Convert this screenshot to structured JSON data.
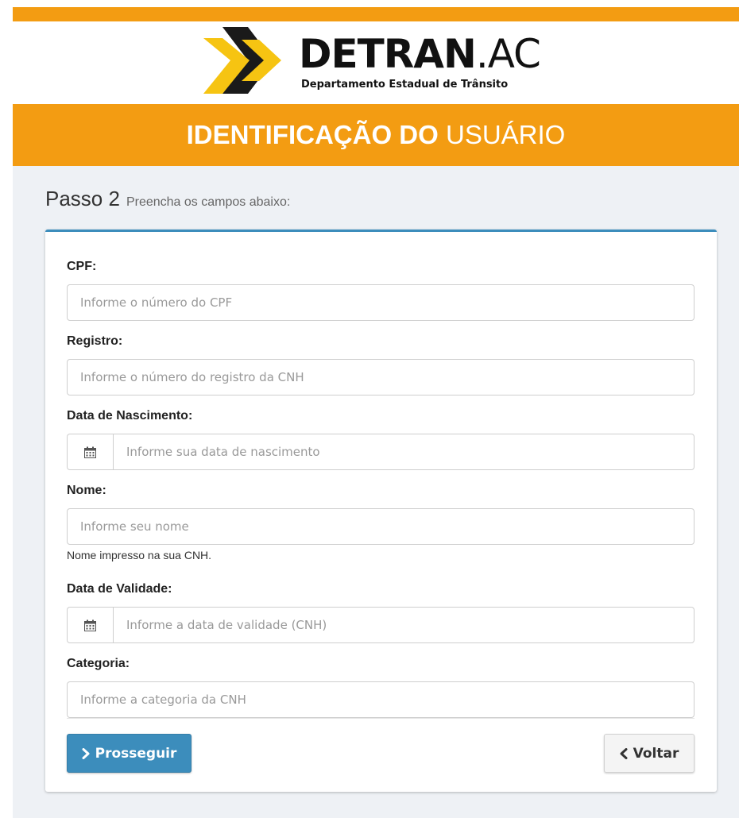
{
  "brand": {
    "name_bold": "DETRAN",
    "name_suffix": ".AC",
    "subtitle": "Departamento Estadual de Trânsito"
  },
  "banner": {
    "title_bold": "IDENTIFICAÇÃO DO",
    "title_light": "USUÁRIO"
  },
  "step": {
    "title": "Passo 2",
    "subtitle": "Preencha os campos abaixo:"
  },
  "form": {
    "cpf": {
      "label": "CPF:",
      "placeholder": "Informe o número do CPF"
    },
    "registro": {
      "label": "Registro:",
      "placeholder": "Informe o número do registro da CNH"
    },
    "nascimento": {
      "label": "Data de Nascimento:",
      "placeholder": "Informe sua data de nascimento",
      "icon": "calendar-icon"
    },
    "nome": {
      "label": "Nome:",
      "placeholder": "Informe seu nome",
      "help": "Nome impresso na sua CNH."
    },
    "validade": {
      "label": "Data de Validade:",
      "placeholder": "Informe a data de validade (CNH)",
      "icon": "calendar-icon"
    },
    "categoria": {
      "label": "Categoria:",
      "placeholder": "Informe a categoria da CNH"
    }
  },
  "actions": {
    "next_label": "Prosseguir",
    "back_label": "Voltar"
  },
  "colors": {
    "accent_orange": "#f39c12",
    "primary_blue": "#3c8dbc",
    "logo_yellow": "#f6c412",
    "logo_black": "#1a1a1a"
  }
}
